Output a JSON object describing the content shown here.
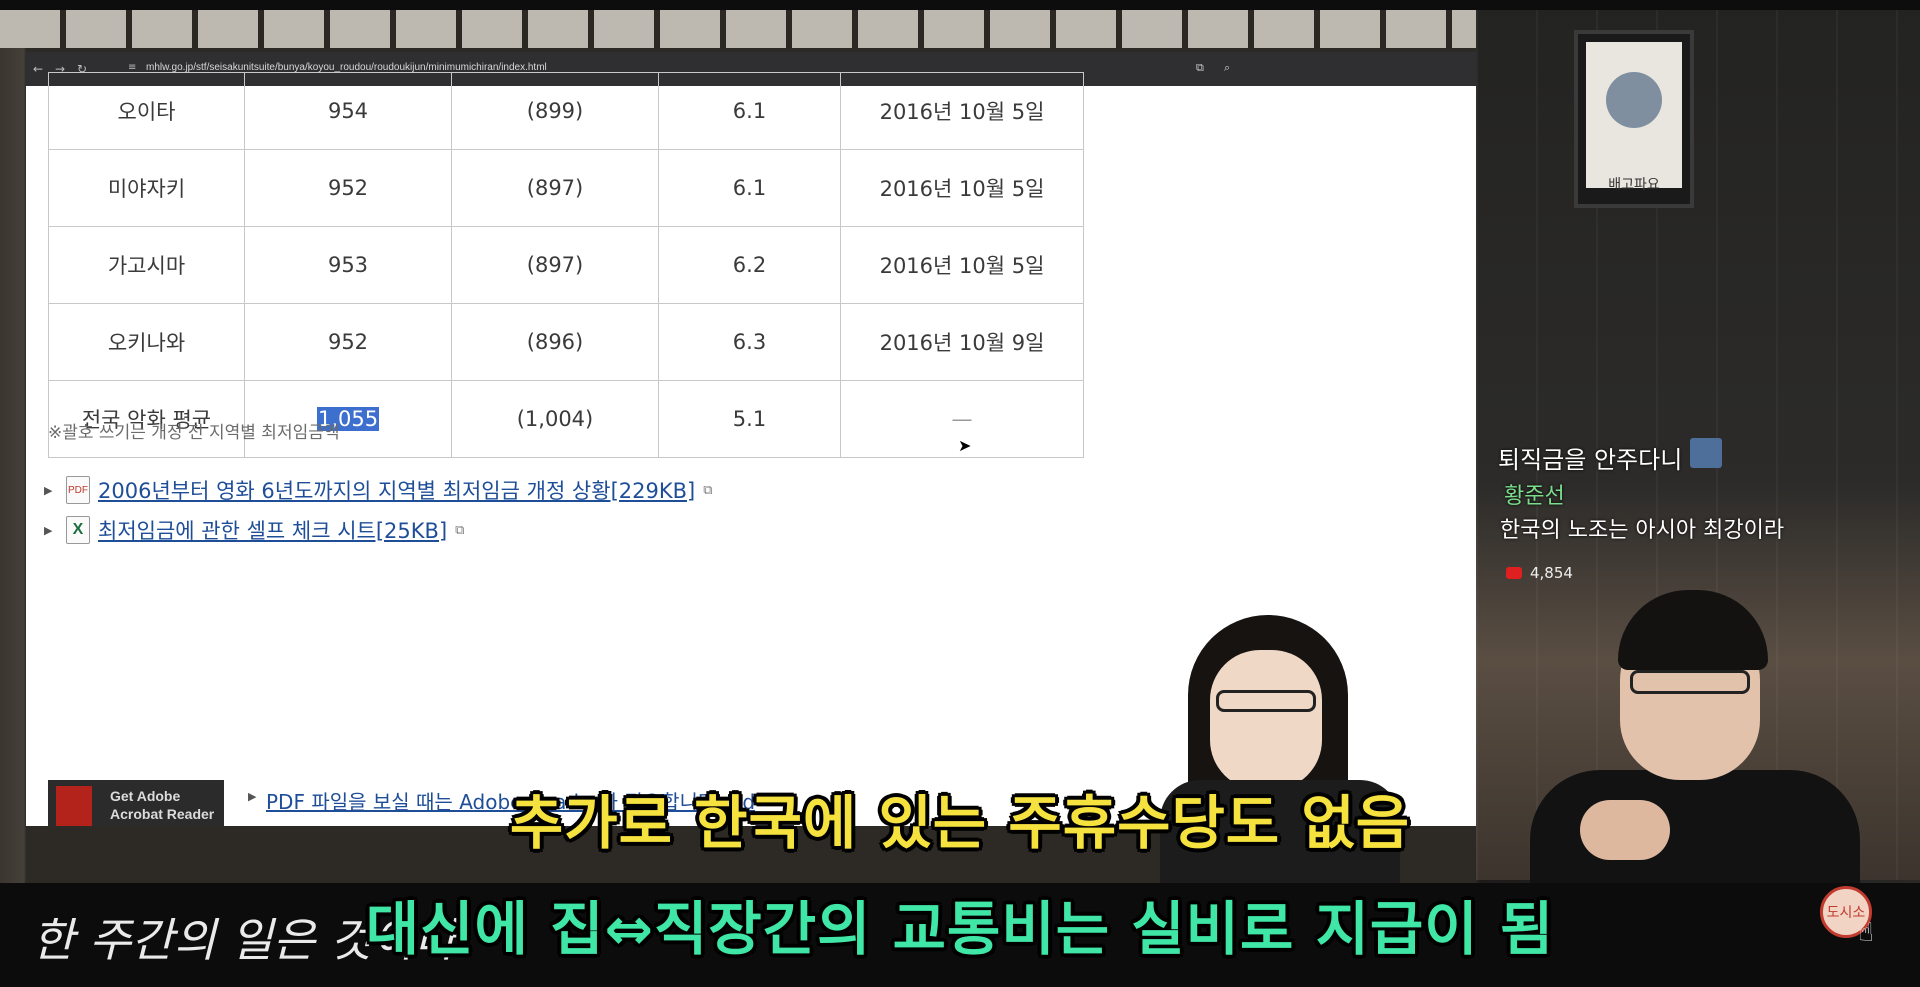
{
  "browser": {
    "url": "mhlw.go.jp/stf/seisakunitsuite/bunya/koyou_roudou/roudoukijun/minimumichiran/index.html"
  },
  "table": {
    "rows": [
      {
        "region": "오이타",
        "wage": "954",
        "prev": "(899)",
        "rate": "6.1",
        "date": "2016년 10월 5일"
      },
      {
        "region": "미야자키",
        "wage": "952",
        "prev": "(897)",
        "rate": "6.1",
        "date": "2016년 10월 5일"
      },
      {
        "region": "가고시마",
        "wage": "953",
        "prev": "(897)",
        "rate": "6.2",
        "date": "2016년 10월 5일"
      },
      {
        "region": "오키나와",
        "wage": "952",
        "prev": "(896)",
        "rate": "6.3",
        "date": "2016년 10월 9일"
      },
      {
        "region": "전국 악화 평균",
        "wage": "1,055",
        "prev": "(1,004)",
        "rate": "5.1",
        "date": "—"
      }
    ]
  },
  "note": "※괄호 쓰기는 개정 전 지역별 최저임금액",
  "links": [
    {
      "icon": "PDF",
      "text": "2006년부터 영화 6년도까지의 지역별 최저임금 개정 상황[229KB]"
    },
    {
      "icon": "X",
      "text": "최저임금에 관한 셀프 체크 시트[25KB]"
    }
  ],
  "adobe": {
    "line1": "Get Adobe",
    "line2": "Acrobat Reader"
  },
  "pdf_help_text": "PDF 파일을 보실 때는 Adobe Reader가 필요합니다. Ad",
  "poster": {
    "caption": "배고파요"
  },
  "chat": {
    "title": "퇴직금을 안주다니",
    "user": "황준선",
    "message": "한국의 노조는 아시아 최강이라",
    "views": "4,854"
  },
  "subtitles": {
    "line1": "추가로 한국에 있는 주휴수당도 없음",
    "line2": "대신에 집⇔직장간의 교통비는 실비로 지급이 됨"
  },
  "handwriting": "한 주간의 일은 것이다",
  "stamp": "도시소"
}
